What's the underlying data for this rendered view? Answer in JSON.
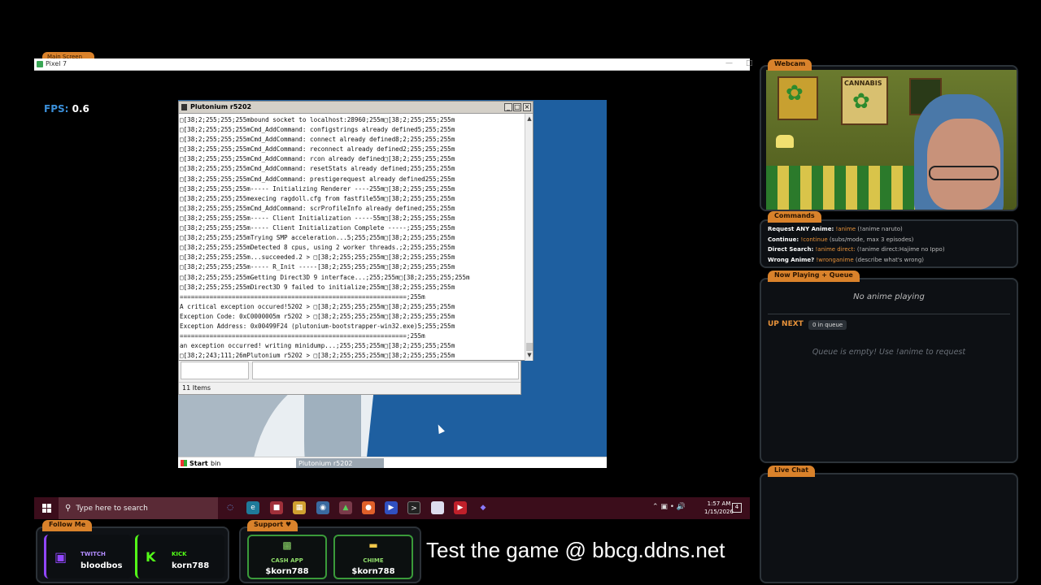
{
  "emulator": {
    "tab_label": "Main Screen",
    "window_title": "Pixel 7",
    "fps_label": "FPS:",
    "fps_value": "0.6"
  },
  "console": {
    "title": "Plutonium r5202",
    "lines": [
      "\u0000[38;2;255;255;255mbound socket to localhost:28960;255m\u0000[38;2;255;255;255m",
      "\u0000[38;2;255;255;255mCmd_AddCommand: configstrings already defined5;255;255m",
      "\u0000[38;2;255;255;255mCmd_AddCommand: connect already defined8;2;255;255;255m",
      "\u0000[38;2;255;255;255mCmd_AddCommand: reconnect already defined2;255;255;255m",
      "\u0000[38;2;255;255;255mCmd_AddCommand: rcon already defined\u0000[38;2;255;255;255m",
      "\u0000[38;2;255;255;255mCmd_AddCommand: resetStats already defined;255;255;255m",
      "\u0000[38;2;255;255;255mCmd_AddCommand: prestigerequest already defined255;255m",
      "\u0000[38;2;255;255;255m----- Initializing Renderer ----255m\u0000[38;2;255;255;255m",
      "\u0000[38;2;255;255;255mexecing ragdoll.cfg from fastfile55m\u0000[38;2;255;255;255m",
      "\u0000[38;2;255;255;255mCmd_AddCommand: scrProfileInfo already defined;255;255m",
      "\u0000[38;2;255;255;255m----- Client Initialization -----55m\u0000[38;2;255;255;255m",
      "\u0000[38;2;255;255;255m----- Client Initialization Complete -----;255;255;255m",
      "\u0000[38;2;255;255;255mTrying SMP acceleration...5;255;255m\u0000[38;2;255;255;255m",
      "\u0000[38;2;255;255;255mDetected 8 cpus, using 2 worker threads.;2;255;255;255m",
      "\u0000[38;2;255;255;255m...succeeded.2 > \u0000[38;2;255;255;255m\u0000[38;2;255;255;255m",
      "\u0000[38;2;255;255;255m----- R_Init -----[38;2;255;255;255m\u0000[38;2;255;255;255m",
      "\u0000[38;2;255;255;255mGetting Direct3D 9 interface...;255;255m\u0000[38;2;255;255;255m",
      "\u0000[38;2;255;255;255mDirect3D 9 failed to initialize;255m\u0000[38;2;255;255;255m",
      "=============================================================;255m",
      "A critical exception occured!5202 > \u0000[38;2;255;255;255m\u0000[38;2;255;255;255m",
      "Exception Code: 0xC0000005m r5202 > \u0000[38;2;255;255;255m\u0000[38;2;255;255;255m",
      "Exception Address: 0x00499F24 (plutonium-bootstrapper-win32.exe)5;255;255m",
      "=============================================================;255m",
      "an exception occurred! writing minidump...;255;255;255m\u0000[38;2;255;255;255m",
      "\u0000[38;2;243;111;26mPlutonium r5202 > \u0000[38;2;255;255;255m\u0000[38;2;255;255;255m"
    ]
  },
  "explorer": {
    "status": "11 Items"
  },
  "xp_taskbar": {
    "start": "Start",
    "item1": "bin",
    "item2": "Plutonium r5202"
  },
  "win10_taskbar": {
    "search_placeholder": "Type here to search",
    "time": "1:57 AM",
    "date": "1/15/2026",
    "notification_count": "4"
  },
  "follow": {
    "tab": "Follow Me",
    "twitch_label": "TWITCH",
    "twitch_user": "bloodbos",
    "kick_label": "KICK",
    "kick_user": "korn788"
  },
  "support": {
    "tab": "Support ♥",
    "cashapp_label": "CASH APP",
    "cashapp_user": "$korn788",
    "chime_label": "CHIME",
    "chime_user": "$korn788"
  },
  "tagline": "Test the game @ bbcg.ddns.net",
  "webcam": {
    "tab": "Webcam",
    "poster_text": "CANNABIS"
  },
  "commands": {
    "tab": "Commands",
    "rows": [
      {
        "key": "Request ANY Anime:",
        "cmd": "!anime",
        "desc": "(!anime naruto)"
      },
      {
        "key": "Continue:",
        "cmd": "!continue",
        "desc": "(subs/mode, max 3 episodes)"
      },
      {
        "key": "Direct Search:",
        "cmd": "!anime direct:",
        "desc": "(!anime direct:Hajime no Ippo)"
      },
      {
        "key": "Wrong Anime?",
        "cmd": "!wronganime",
        "desc": "(describe what's wrong)"
      }
    ]
  },
  "now_playing": {
    "tab": "Now Playing + Queue",
    "status": "No anime playing",
    "up_next": "UP NEXT",
    "queue_badge": "0 in queue",
    "empty_msg": "Queue is empty! Use !anime to request"
  },
  "live_chat": {
    "tab": "Live Chat"
  },
  "colors": {
    "accent_orange": "#d9822b",
    "twitch": "#9146ff",
    "kick": "#53fc18",
    "cash_green": "#3a9a3a"
  }
}
